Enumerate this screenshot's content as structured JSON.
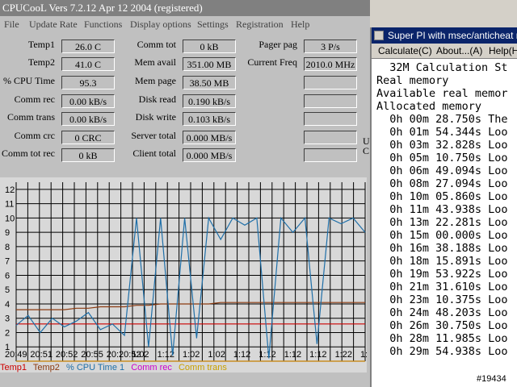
{
  "cpucool": {
    "title": "CPUCooL  Vers 7.2.12  Apr 12 2004  (registered)",
    "menu": [
      "File",
      "Update Rate",
      "Functions",
      "Display options",
      "Settings",
      "Registration",
      "Help"
    ],
    "col1": [
      {
        "label": "Temp1",
        "value": "26.0 C"
      },
      {
        "label": "Temp2",
        "value": "41.0 C"
      },
      {
        "label": "% CPU Time",
        "value": "95.3"
      },
      {
        "label": "Comm rec",
        "value": "0.00 kB/s"
      },
      {
        "label": "Comm trans",
        "value": "0.00 kB/s"
      },
      {
        "label": "Comm crc",
        "value": "0 CRC"
      },
      {
        "label": "Comm tot rec",
        "value": "0 kB"
      }
    ],
    "col2": [
      {
        "label": "Comm tot",
        "value": "0 kB"
      },
      {
        "label": "Mem avail",
        "value": "351.00 MB"
      },
      {
        "label": "Mem page",
        "value": "38.50 MB"
      },
      {
        "label": "Disk read",
        "value": "0.190 kB/s"
      },
      {
        "label": "Disk write",
        "value": "0.103 kB/s"
      },
      {
        "label": "Server total",
        "value": "0.000 MB/s"
      },
      {
        "label": "Client total",
        "value": "0.000 MB/s"
      }
    ],
    "col3": [
      {
        "label": "Pager pag",
        "value": "3 P/s"
      },
      {
        "label": "Current Freq",
        "value": "2010.0 MHz"
      },
      {
        "label": "",
        "value": ""
      },
      {
        "label": "",
        "value": ""
      },
      {
        "label": "",
        "value": ""
      },
      {
        "label": "",
        "value": ""
      },
      {
        "label": "",
        "value": ""
      }
    ],
    "side_text": [
      "U",
      "C"
    ]
  },
  "chart_data": {
    "type": "line",
    "y_ticks": [
      "12",
      "11",
      "10",
      "9",
      "8",
      "7",
      "6",
      "5",
      "4",
      "3",
      "2",
      "1"
    ],
    "ylim": [
      0,
      12.5
    ],
    "x_tick_labels": [
      "20:49",
      "20:51",
      "20:52",
      "20:55",
      "20:20:52",
      "1:02",
      "1:12",
      "1:02",
      "1:02",
      "1:12",
      "1:12",
      "1:12",
      "1:12",
      "1:22",
      "1:"
    ],
    "grid": true,
    "series": [
      {
        "name": "Temp1",
        "color": "#cc0000",
        "values": [
          2.6,
          2.6,
          2.6,
          2.6,
          2.6,
          2.6,
          2.6,
          2.6,
          2.6,
          2.6,
          2.6,
          2.6,
          2.6,
          2.6,
          2.6,
          2.6,
          2.6,
          2.6,
          2.6,
          2.6,
          2.6,
          2.6,
          2.6,
          2.6,
          2.6,
          2.6,
          2.6,
          2.6,
          2.6,
          2.6
        ]
      },
      {
        "name": "Temp2",
        "color": "#8b3a10",
        "values": [
          3.6,
          3.6,
          3.6,
          3.6,
          3.6,
          3.7,
          3.7,
          3.8,
          3.8,
          3.8,
          3.9,
          3.9,
          4.0,
          4.0,
          4.0,
          4.0,
          4.0,
          4.1,
          4.1,
          4.1,
          4.1,
          4.1,
          4.1,
          4.1,
          4.1,
          4.1,
          4.1,
          4.1,
          4.1,
          4.1
        ]
      },
      {
        "name": "% CPU Time 1",
        "color": "#1f6fa8",
        "values": [
          2.5,
          3.2,
          2.0,
          3.0,
          2.4,
          2.8,
          3.4,
          2.2,
          2.6,
          1.8,
          10,
          1.0,
          10,
          0.4,
          10,
          1.6,
          10,
          8.5,
          10,
          9.5,
          10,
          0.2,
          10,
          9,
          10,
          1.2,
          10,
          9.6,
          10,
          9.0
        ]
      },
      {
        "name": "Comm rec",
        "color": "#cc00cc",
        "values": [
          0,
          0,
          0,
          0,
          0,
          0,
          0,
          0,
          0,
          0,
          0,
          0,
          0,
          0,
          0,
          0,
          0,
          0,
          0,
          0,
          0,
          0,
          0,
          0,
          0,
          0,
          0,
          0,
          0,
          0
        ]
      },
      {
        "name": "Comm trans",
        "color": "#c8a000",
        "values": [
          0,
          0,
          0,
          0,
          0,
          0,
          0,
          0,
          0,
          0,
          0,
          0,
          0,
          0,
          0,
          0,
          0,
          0,
          0,
          0,
          0,
          0,
          0,
          0,
          0,
          0,
          0,
          0,
          0,
          0
        ]
      }
    ]
  },
  "legend": [
    {
      "label": "Temp1",
      "color": "#cc0000"
    },
    {
      "label": "Temp2",
      "color": "#8b3a10"
    },
    {
      "label": "% CPU Time 1",
      "color": "#1f6fa8"
    },
    {
      "label": "Comm rec",
      "color": "#cc00cc"
    },
    {
      "label": "Comm trans",
      "color": "#c8a000"
    }
  ],
  "superpi": {
    "title": "Super PI with msec/anticheat mod",
    "menu": [
      "Calculate(C)",
      "About...(A)",
      "Help(H)"
    ],
    "lines": [
      "  32M Calculation St",
      "Real memory",
      "Available real memor",
      "Allocated memory",
      "  0h 00m 28.750s The",
      "  0h 01m 54.344s Loo",
      "  0h 03m 32.828s Loo",
      "  0h 05m 10.750s Loo",
      "  0h 06m 49.094s Loo",
      "  0h 08m 27.094s Loo",
      "  0h 10m 05.860s Loo",
      "  0h 11m 43.938s Loo",
      "  0h 13m 22.281s Loo",
      "  0h 15m 00.000s Loo",
      "  0h 16m 38.188s Loo",
      "  0h 18m 15.891s Loo",
      "  0h 19m 53.922s Loo",
      "  0h 21m 31.610s Loo",
      "  0h 23m 10.375s Loo",
      "  0h 24m 48.203s Loo",
      "  0h 26m 30.750s Loo",
      "  0h 28m 11.985s Loo",
      "  0h 29m 54.938s Loo"
    ]
  },
  "watermark": "#19434"
}
